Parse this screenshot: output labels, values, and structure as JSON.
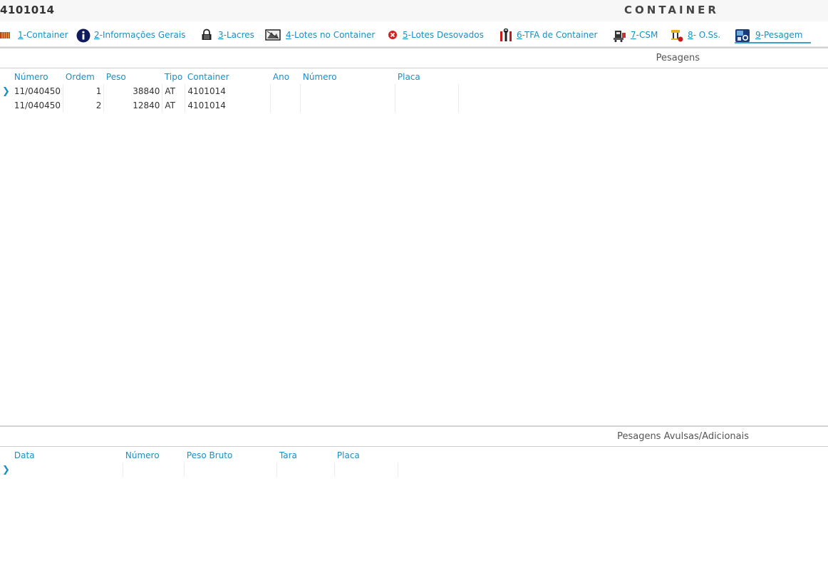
{
  "header": {
    "container_id": "4101014",
    "module_title": "CONTAINER"
  },
  "tabs": [
    {
      "key": "1",
      "label": "-Container",
      "icon": "container-icon"
    },
    {
      "key": "2",
      "label": "-Informações Gerais",
      "icon": "info-icon"
    },
    {
      "key": "3",
      "label": "-Lacres",
      "icon": "lock-icon"
    },
    {
      "key": "4",
      "label": "-Lotes no Container",
      "icon": "lots-icon"
    },
    {
      "key": "5",
      "label": "-Lotes Desovados",
      "icon": "cancel-icon"
    },
    {
      "key": "6",
      "label": "-TFA de Container",
      "icon": "tools-icon"
    },
    {
      "key": "7",
      "label": "-CSM",
      "icon": "csm-icon"
    },
    {
      "key": "8",
      "label": "- O.Ss.",
      "icon": "service-order-icon"
    },
    {
      "key": "9",
      "label": "-Pesagem",
      "icon": "weighing-icon",
      "active": true
    }
  ],
  "pesagens": {
    "title": "Pesagens",
    "columns": [
      "Número",
      "Ordem",
      "Peso",
      "Tipo",
      "Container",
      "Ano",
      "Número",
      "Placa"
    ],
    "rows": [
      {
        "numero": "11/040450",
        "ordem": "1",
        "peso": "38840",
        "tipo": "AT",
        "container": "4101014",
        "ano": "",
        "numero2": "",
        "placa": ""
      },
      {
        "numero": "11/040450",
        "ordem": "2",
        "peso": "12840",
        "tipo": "AT",
        "container": "4101014",
        "ano": "",
        "numero2": "",
        "placa": ""
      }
    ]
  },
  "avulsas": {
    "title": "Pesagens Avulsas/Adicionais",
    "columns": [
      "Data",
      "Número",
      "Peso Bruto",
      "Tara",
      "Placa"
    ]
  },
  "colors": {
    "accent": "#1a8fc3",
    "active_tab_underline": "#3aa3c9"
  }
}
